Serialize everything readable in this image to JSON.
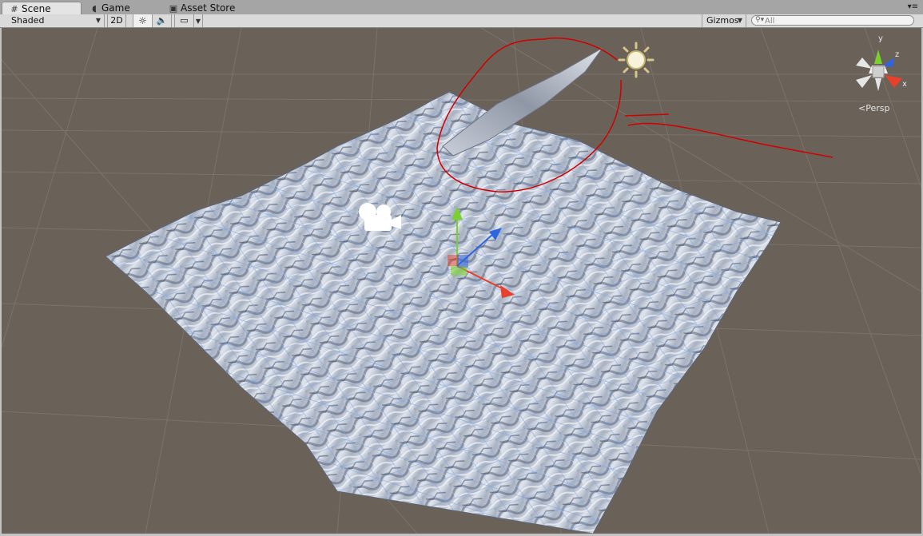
{
  "tabs": [
    {
      "label": "Scene",
      "icon": "grid-icon",
      "active": true
    },
    {
      "label": "Game",
      "icon": "pacman-icon",
      "active": false
    },
    {
      "label": "Asset Store",
      "icon": "bag-icon",
      "active": false
    }
  ],
  "toolbar": {
    "render_mode": "Shaded",
    "two_d_label": "2D",
    "gizmos_label": "Gizmos",
    "search_placeholder": "All"
  },
  "scene": {
    "projection_label": "Persp",
    "axes": {
      "y": "y",
      "z": "z",
      "x": "x"
    },
    "colors": {
      "background": "#6a6259",
      "grid": "#7d756c",
      "terrain_base": "#c9d2de",
      "wire": "#7fa3de",
      "annotation": "#d10000",
      "axis_x": "#e8402a",
      "axis_y": "#7ad12e",
      "axis_z": "#2f64e0"
    }
  }
}
